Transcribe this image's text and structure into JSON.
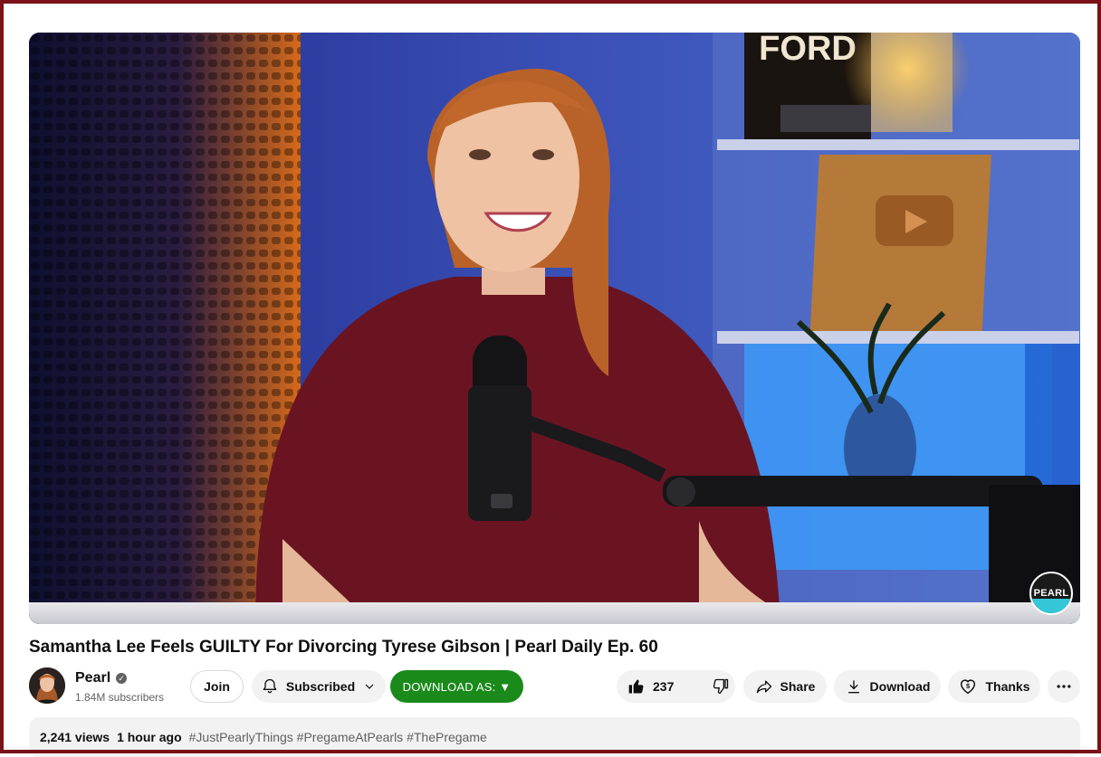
{
  "video": {
    "watermark": "PEARL",
    "sign_text": "FORD"
  },
  "title": "Samantha Lee Feels GUILTY For Divorcing Tyrese Gibson | Pearl Daily Ep. 60",
  "channel": {
    "name": "Pearl",
    "subscribers": "1.84M subscribers",
    "verified_icon": "check-circle-icon"
  },
  "actions": {
    "join": "Join",
    "subscribed": "Subscribed",
    "download_as": "DOWNLOAD AS: ▼",
    "likes": "237",
    "share": "Share",
    "download": "Download",
    "thanks": "Thanks",
    "more_icon": "more-horizontal-icon"
  },
  "description": {
    "views": "2,241 views",
    "time": "1 hour ago",
    "tags": "#JustPearlyThings #PregameAtPearls #ThePregame"
  },
  "colors": {
    "frame": "#7a1118",
    "download_as_bg": "#1a8a1a",
    "pill_bg": "#f2f2f2"
  }
}
